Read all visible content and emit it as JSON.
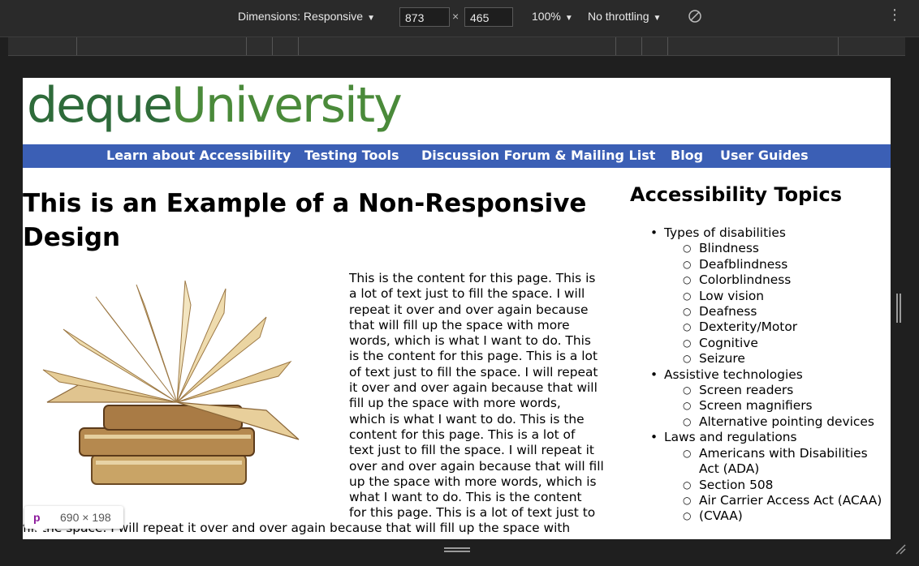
{
  "devtools": {
    "dimensions_label": "Dimensions: Responsive",
    "width_value": "873",
    "times": "×",
    "height_value": "465",
    "zoom": "100%",
    "throttling": "No throttling",
    "caret": "▼",
    "more_menu": "⋮"
  },
  "site": {
    "logo_part1": "deque",
    "logo_part2": "University",
    "nav": [
      "Learn about Accessibility",
      "Testing Tools",
      "Discussion Forum & Mailing List",
      "Blog",
      "User Guides"
    ],
    "page_title": "This is an Example of a Non-Responsive Design",
    "content_lines": [
      "This is the content for this page. This is",
      "a lot of text just to fill the space. I will",
      "repeat it over and over again because",
      "that will fill up the space with more",
      "words, which is what I want to do. This",
      "is the content for this page. This is a lot",
      "of text just to fill the space. I will repeat",
      "it over and over again because that will",
      "fill up the space with more words,",
      "which is what I want to do. This is the",
      "content for this page. This is a lot of",
      "text just to fill the space. I will repeat it",
      "over and over again because that will fill",
      "up the space with more words, which is",
      "what I want to do. This is the content",
      "for this page. This is a lot of text just to"
    ],
    "content_tail": "fill the space. I will repeat it over and over again because that will fill up the space with",
    "sidebar_title": "Accessibility Topics",
    "topics": [
      {
        "label": "Types of disabilities",
        "children": [
          "Blindness",
          "Deafblindness",
          "Colorblindness",
          "Low vision",
          "Deafness",
          "Dexterity/Motor",
          "Cognitive",
          "Seizure"
        ]
      },
      {
        "label": "Assistive technologies",
        "children": [
          "Screen readers",
          "Screen magnifiers",
          "Alternative pointing devices"
        ]
      },
      {
        "label": "Laws and regulations",
        "children": [
          "Americans with Disabilities Act (ADA)",
          "Section 508",
          "Air Carrier Access Act (ACAA)",
          "(CVAA)"
        ]
      }
    ]
  },
  "inspector": {
    "tag": "p",
    "size": "690 × 198"
  },
  "colors": {
    "nav_bg": "#3b5fb5",
    "logo_dark": "#2e6b3a",
    "logo_green": "#4a8a3a"
  }
}
